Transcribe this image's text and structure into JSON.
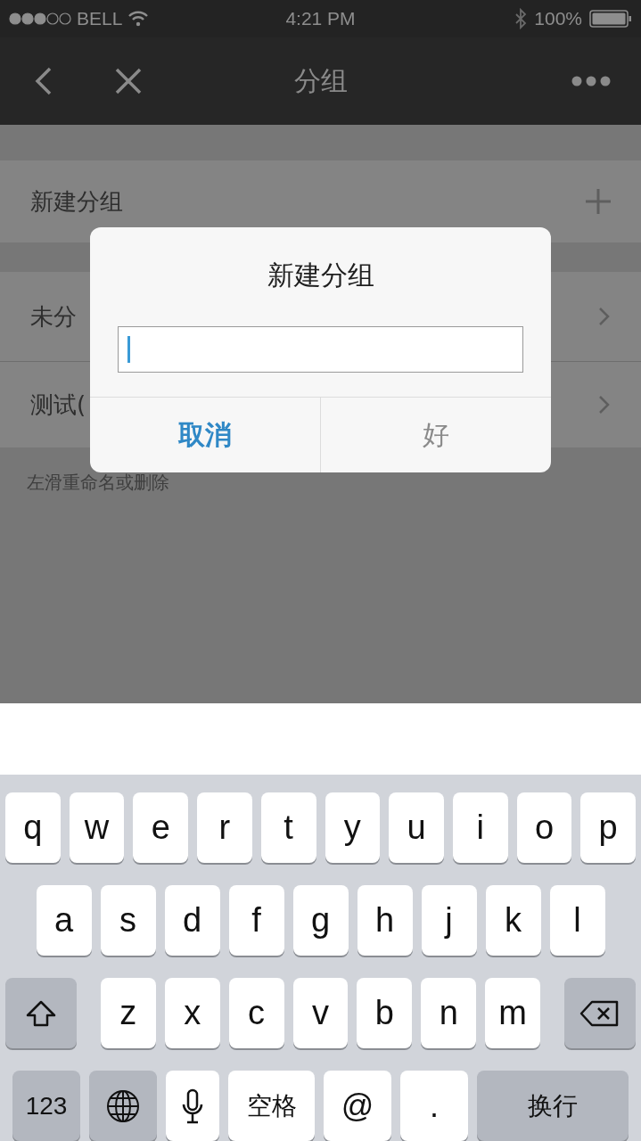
{
  "status_bar": {
    "carrier": "BELL",
    "time": "4:21 PM",
    "battery": "100%"
  },
  "nav": {
    "title": "分组"
  },
  "list": {
    "add_row": {
      "label": "新建分组"
    },
    "groups": [
      {
        "label": "未分"
      },
      {
        "label": "测试("
      }
    ],
    "hint": "左滑重命名或删除"
  },
  "dialog": {
    "title": "新建分组",
    "input": {
      "focused": true
    },
    "buttons": [
      {
        "label": "取消",
        "kind": "primary"
      },
      {
        "label": "好",
        "kind": "normal"
      }
    ]
  },
  "keyboard": {
    "rows": [
      [
        {
          "kind": "letter",
          "label": "q"
        },
        {
          "kind": "letter",
          "label": "w"
        },
        {
          "kind": "letter",
          "label": "e"
        },
        {
          "kind": "letter",
          "label": "r"
        },
        {
          "kind": "letter",
          "label": "t"
        },
        {
          "kind": "letter",
          "label": "y"
        },
        {
          "kind": "letter",
          "label": "u"
        },
        {
          "kind": "letter",
          "label": "i"
        },
        {
          "kind": "letter",
          "label": "o"
        },
        {
          "kind": "letter",
          "label": "p"
        }
      ],
      [
        {
          "kind": "letter",
          "label": "a"
        },
        {
          "kind": "letter",
          "label": "s"
        },
        {
          "kind": "letter",
          "label": "d"
        },
        {
          "kind": "letter",
          "label": "f"
        },
        {
          "kind": "letter",
          "label": "g"
        },
        {
          "kind": "letter",
          "label": "h"
        },
        {
          "kind": "letter",
          "label": "j"
        },
        {
          "kind": "letter",
          "label": "k"
        },
        {
          "kind": "letter",
          "label": "l"
        }
      ],
      [
        {
          "kind": "shift"
        },
        {
          "kind": "letter",
          "label": "z"
        },
        {
          "kind": "letter",
          "label": "x"
        },
        {
          "kind": "letter",
          "label": "c"
        },
        {
          "kind": "letter",
          "label": "v"
        },
        {
          "kind": "letter",
          "label": "b"
        },
        {
          "kind": "letter",
          "label": "n"
        },
        {
          "kind": "letter",
          "label": "m"
        },
        {
          "kind": "backspace"
        }
      ],
      [
        {
          "kind": "numbers",
          "label": "123"
        },
        {
          "kind": "globe"
        },
        {
          "kind": "mic"
        },
        {
          "kind": "space",
          "label": "空格"
        },
        {
          "kind": "symbol",
          "label": "@"
        },
        {
          "kind": "symbol",
          "label": "."
        },
        {
          "kind": "return",
          "label": "换行"
        }
      ]
    ]
  }
}
